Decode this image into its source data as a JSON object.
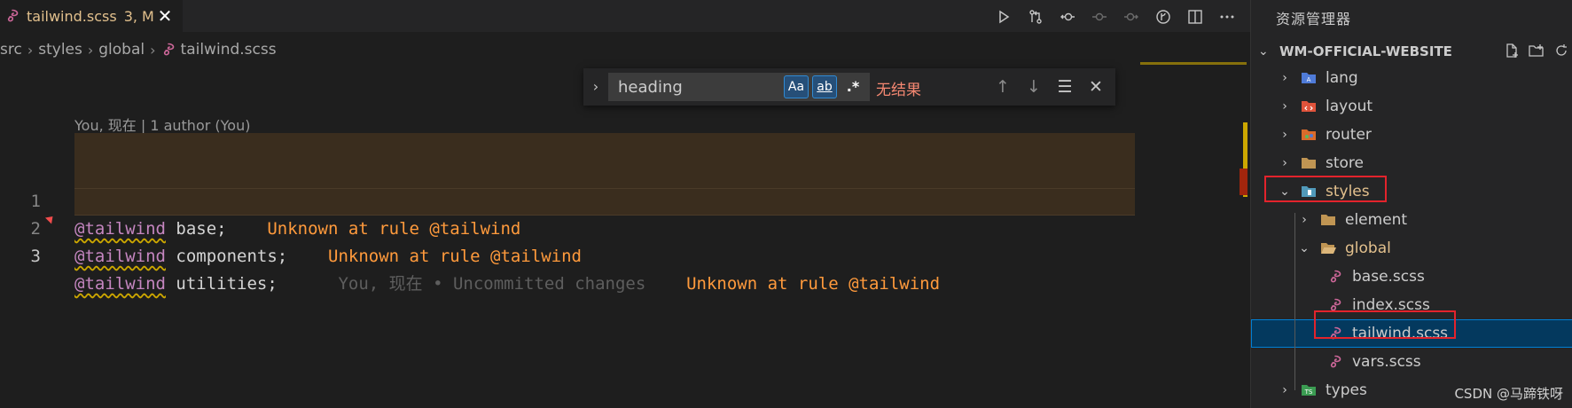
{
  "tab": {
    "filename": "tailwind.scss",
    "status": "3, M",
    "close_glyph": "✕"
  },
  "breadcrumb": [
    "src",
    "styles",
    "global",
    "tailwind.scss"
  ],
  "find": {
    "query": "heading",
    "match_case_label": "Aa",
    "whole_word_label": "ab",
    "regex_label": ".*",
    "no_results": "无结果"
  },
  "codelens": "You, 现在 | 1 author (You)",
  "code": {
    "lines": [
      {
        "num": "1",
        "at": "@tailwind",
        "arg": " base;",
        "pad": "    ",
        "diagnostic": "Unknown at rule @tailwind",
        "blame": ""
      },
      {
        "num": "2",
        "at": "@tailwind",
        "arg": " components;",
        "pad": "    ",
        "diagnostic": "Unknown at rule @tailwind",
        "blame": ""
      },
      {
        "num": "3",
        "at": "@tailwind",
        "arg": " utilities;",
        "pad": "      ",
        "diagnostic": "Unknown at rule @tailwind",
        "blame": "You, 现在 • Uncommitted changes"
      }
    ]
  },
  "explorer": {
    "title": "资源管理器",
    "root": "WM-OFFICIAL-WEBSITE",
    "items": [
      {
        "label": "lang",
        "icon": "lang-folder-icon",
        "color": "#4f7bd8"
      },
      {
        "label": "layout",
        "icon": "layout-folder-icon",
        "color": "#e0533b"
      },
      {
        "label": "router",
        "icon": "router-folder-icon",
        "color": "#d96b2b"
      },
      {
        "label": "store",
        "icon": "folder-icon",
        "color": "#c09553"
      },
      {
        "label": "styles",
        "icon": "styles-folder-icon",
        "color": "#519aba"
      },
      {
        "label": "element",
        "icon": "folder-icon",
        "color": "#c09553"
      },
      {
        "label": "global",
        "icon": "folder-open-icon",
        "color": "#c09553"
      },
      {
        "label": "base.scss",
        "icon": "sass-icon",
        "color": "#cd6799"
      },
      {
        "label": "index.scss",
        "icon": "sass-icon",
        "color": "#cd6799"
      },
      {
        "label": "tailwind.scss",
        "icon": "sass-icon",
        "color": "#cd6799"
      },
      {
        "label": "vars.scss",
        "icon": "sass-icon",
        "color": "#cd6799"
      },
      {
        "label": "types",
        "icon": "ts-folder-icon",
        "color": "#3b9c52"
      }
    ]
  },
  "watermark": "CSDN @马蹄铁呀"
}
